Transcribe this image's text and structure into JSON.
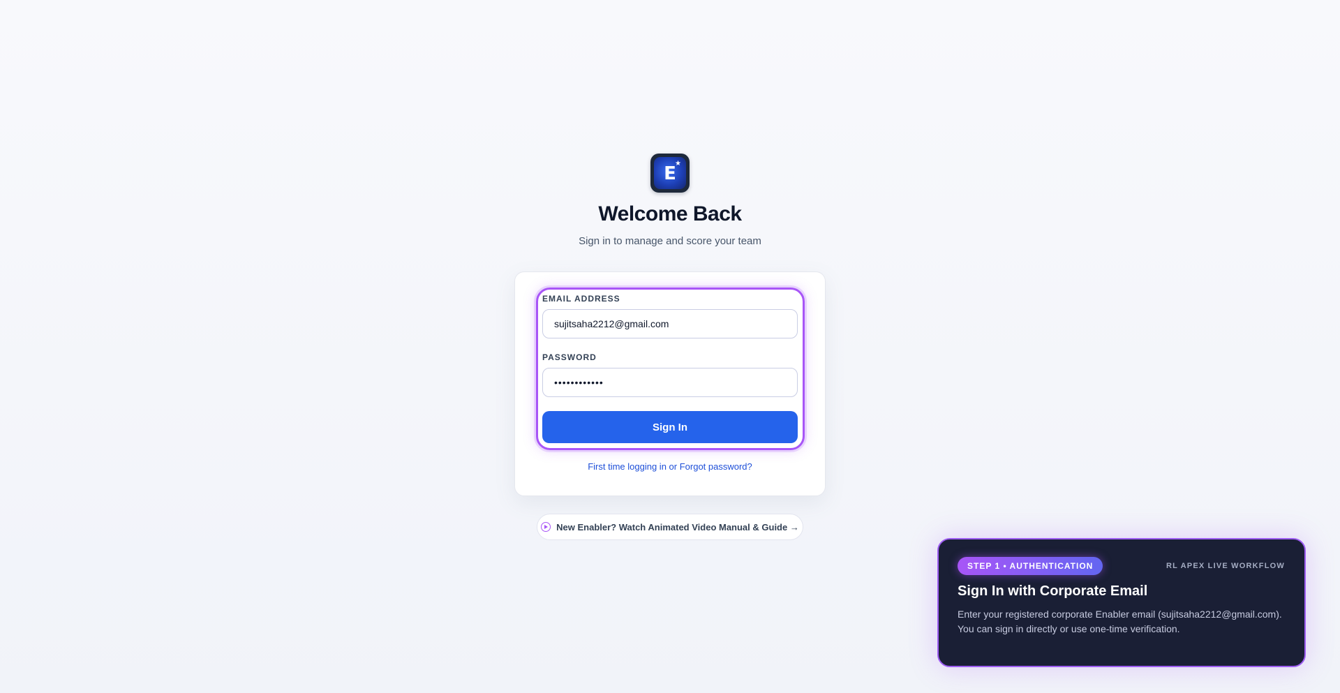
{
  "brand": {
    "logo_letter": "E",
    "logo_icon": "star-icon"
  },
  "header": {
    "title": "Welcome Back",
    "subtitle": "Sign in to manage and score your team"
  },
  "form": {
    "email_label": "EMAIL ADDRESS",
    "email_value": "sujitsaha2212@gmail.com",
    "password_label": "PASSWORD",
    "password_value": "••••••••••••",
    "submit_label": "Sign In",
    "forgot_link": "First time logging in or Forgot password?"
  },
  "video_guide": {
    "label": "New Enabler? Watch Animated Video Manual & Guide →",
    "icon": "play-circle-icon"
  },
  "tour": {
    "badge": "STEP 1 • AUTHENTICATION",
    "tag": "RL APEX LIVE WORKFLOW",
    "title": "Sign In with Corporate Email",
    "body": "Enter your registered corporate Enabler email (sujitsaha2212@gmail.com). You can sign in directly or use one-time verification."
  },
  "colors": {
    "primary": "#2563eb",
    "accent": "#a855f7",
    "tour_bg": "#1a1f35",
    "link": "#1d4ed8"
  }
}
